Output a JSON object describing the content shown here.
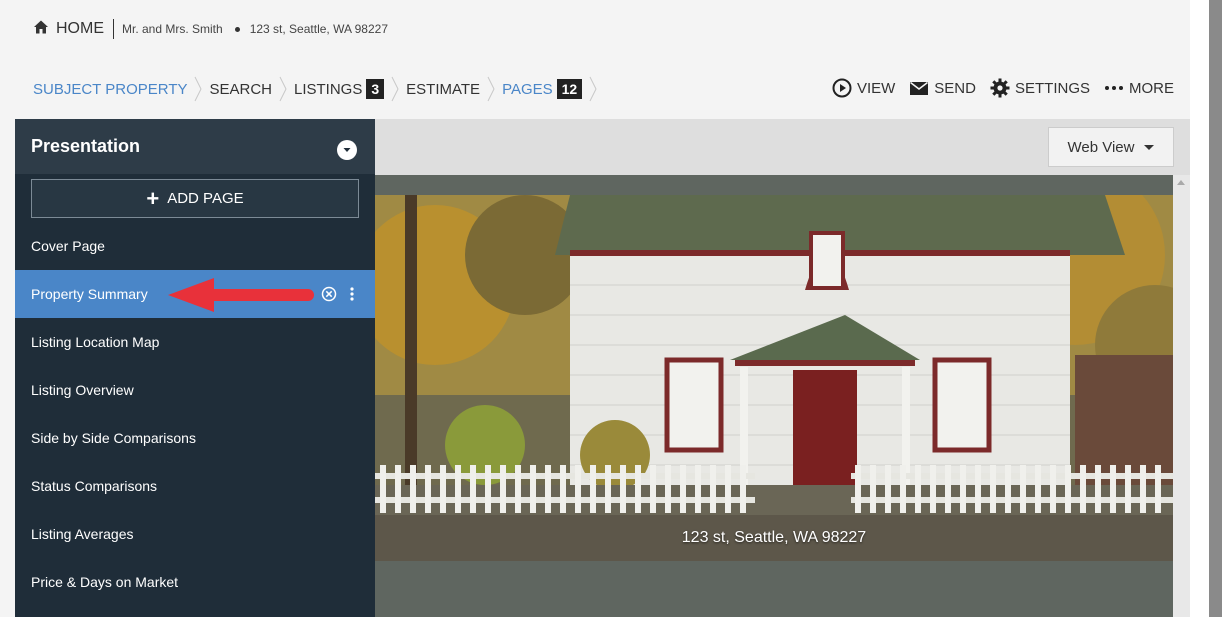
{
  "header": {
    "home_label": "HOME",
    "client_name": "Mr. and Mrs. Smith",
    "address": "123 st, Seattle, WA 98227"
  },
  "breadcrumb": [
    {
      "label": "SUBJECT PROPERTY",
      "color": "#4a86c8"
    },
    {
      "label": "SEARCH"
    },
    {
      "label": "LISTINGS",
      "count": "3"
    },
    {
      "label": "ESTIMATE"
    },
    {
      "label": "PAGES",
      "count": "12",
      "color": "#4a86c8"
    }
  ],
  "actions": [
    {
      "label": "VIEW",
      "icon": "play-circle-icon"
    },
    {
      "label": "SEND",
      "icon": "envelope-icon"
    },
    {
      "label": "SETTINGS",
      "icon": "gear-icon"
    },
    {
      "label": "MORE",
      "icon": "ellipsis-icon"
    }
  ],
  "sidebar": {
    "title": "Presentation",
    "add_page_label": "ADD PAGE",
    "items": [
      {
        "label": "Cover Page"
      },
      {
        "label": "Property Summary",
        "active": true
      },
      {
        "label": "Listing Location Map"
      },
      {
        "label": "Listing Overview"
      },
      {
        "label": "Side by Side Comparisons"
      },
      {
        "label": "Status Comparisons"
      },
      {
        "label": "Listing Averages"
      },
      {
        "label": "Price & Days on Market"
      }
    ]
  },
  "main": {
    "view_select": "Web View",
    "photo_caption": "123 st, Seattle, WA 98227"
  },
  "colors": {
    "accent": "#4a86c8",
    "sidebar_bg": "#1f2d39",
    "annotation_arrow": "#e8313a"
  }
}
